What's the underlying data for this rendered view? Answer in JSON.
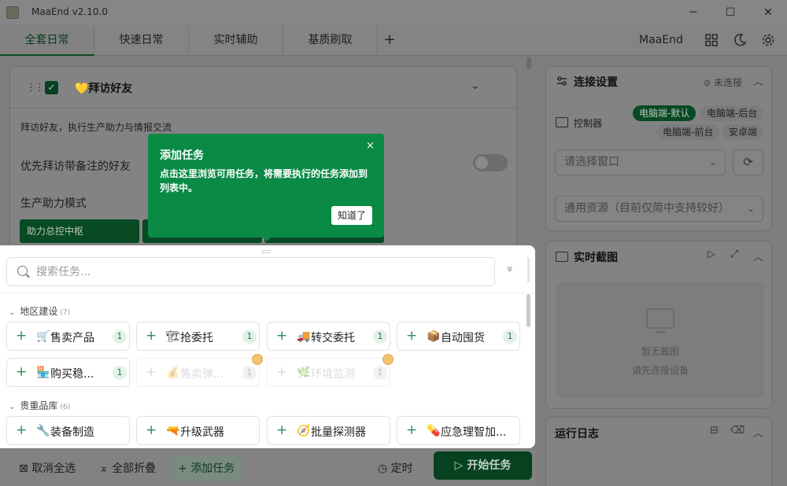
{
  "window": {
    "title": "MaaEnd v2.10.0",
    "minimize": "─",
    "maximize": "☐",
    "close": "✕"
  },
  "tabs": [
    {
      "label": "全套日常"
    },
    {
      "label": "快速日常"
    },
    {
      "label": "实时辅助"
    },
    {
      "label": "基质刷取"
    }
  ],
  "tab_add": "+",
  "brand": "MaaEnd",
  "task_card": {
    "checkbox": "✓",
    "title": "💛拜访好友",
    "chevron": "⌄",
    "description": "拜访好友，执行生产助力与情报交流",
    "option_label": "优先拜访带备注的好友",
    "option_on": false,
    "mode_label": "生产助力模式",
    "mode_options": [
      "助力总控中枢",
      "",
      ""
    ]
  },
  "tooltip": {
    "title": "添加任务",
    "close": "×",
    "body": "点击这里浏览可用任务，将需要执行的任务添加到列表中。",
    "ok": "知道了"
  },
  "add_panel": {
    "search_placeholder": "搜索任务...",
    "expand": "»",
    "categories": [
      {
        "name": "地区建设",
        "count": "(7)",
        "caret": "⌄",
        "items": [
          {
            "emoji": "🛒",
            "label": "售卖产品",
            "count": "1",
            "disabled": false
          },
          {
            "emoji": "🏗",
            "label": "抢委托",
            "count": "1",
            "disabled": false
          },
          {
            "emoji": "🚚",
            "label": "转交委托",
            "count": "1",
            "disabled": false
          },
          {
            "emoji": "📦",
            "label": "自动囤货",
            "count": "1",
            "disabled": false
          },
          {
            "emoji": "🏪",
            "label": "购买稳...",
            "count": "1",
            "disabled": false
          },
          {
            "emoji": "💰",
            "label": "售卖弹...",
            "count": "1",
            "disabled": true
          },
          {
            "emoji": "🌿",
            "label": "环境监测",
            "count": "1",
            "disabled": true
          }
        ]
      },
      {
        "name": "贵重品库",
        "count": "(6)",
        "caret": "⌄",
        "items": [
          {
            "emoji": "🔧",
            "label": "装备制造"
          },
          {
            "emoji": "🔫",
            "label": "升级武器"
          },
          {
            "emoji": "🧭",
            "label": "批量探测器"
          },
          {
            "emoji": "💊",
            "label": "应急理智加..."
          }
        ]
      }
    ]
  },
  "connection": {
    "title": "连接设置",
    "status": "未连接",
    "controller_label": "控制器",
    "controllers": [
      "电脑端-默认",
      "电脑端-后台",
      "电脑端-前台",
      "安卓端"
    ],
    "selected_controller": "电脑端-默认",
    "window_placeholder": "请选择窗口",
    "resource": "通用资源（目前仅简中支持较好）"
  },
  "screenshot": {
    "title": "实时截图",
    "empty": "暂无截图",
    "hint": "请先连接设备"
  },
  "log": {
    "title": "运行日志"
  },
  "bottom": {
    "deselect_all": "取消全选",
    "collapse_all": "全部折叠",
    "add_task": "添加任务",
    "timer": "定时",
    "start": "开始任务"
  },
  "colors": {
    "accent": "#0a8a45",
    "dark_accent": "#074a23",
    "badge_bg": "#e3f1e8"
  }
}
